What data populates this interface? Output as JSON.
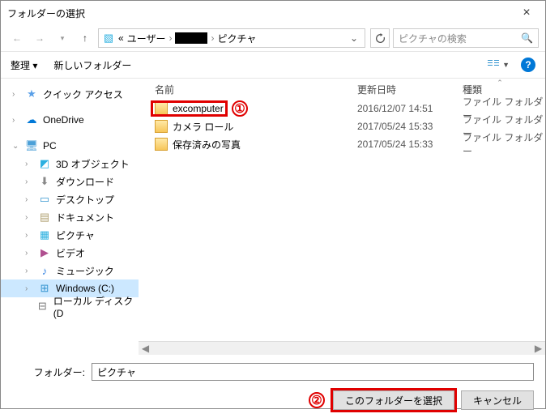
{
  "title": "フォルダーの選択",
  "breadcrumb": {
    "seg1": "ユーザー",
    "seg2": "ピクチャ",
    "chevL": "«",
    "chevR": "›"
  },
  "search": {
    "placeholder": "ピクチャの検索"
  },
  "toolbar": {
    "organize": "整理 ▾",
    "newfolder": "新しいフォルダー"
  },
  "tree": {
    "quick": "クイック アクセス",
    "onedrive": "OneDrive",
    "pc": "PC",
    "obj3d": "3D オブジェクト",
    "downloads": "ダウンロード",
    "desktop": "デスクトップ",
    "documents": "ドキュメント",
    "pictures": "ピクチャ",
    "videos": "ビデオ",
    "music": "ミュージック",
    "windows": "Windows (C:)",
    "localdisk": "ローカル ディスク (D"
  },
  "cols": {
    "name": "名前",
    "date": "更新日時",
    "type": "種類"
  },
  "rows": [
    {
      "name": "excomputer",
      "date": "2016/12/07 14:51",
      "type": "ファイル フォルダー"
    },
    {
      "name": "カメラ ロール",
      "date": "2017/05/24 15:33",
      "type": "ファイル フォルダー"
    },
    {
      "name": "保存済みの写真",
      "date": "2017/05/24 15:33",
      "type": "ファイル フォルダー"
    }
  ],
  "footer": {
    "folder_label": "フォルダー:",
    "folder_value": "ピクチャ",
    "select": "このフォルダーを選択",
    "cancel": "キャンセル"
  },
  "anno": {
    "a1": "①",
    "a2": "②"
  }
}
